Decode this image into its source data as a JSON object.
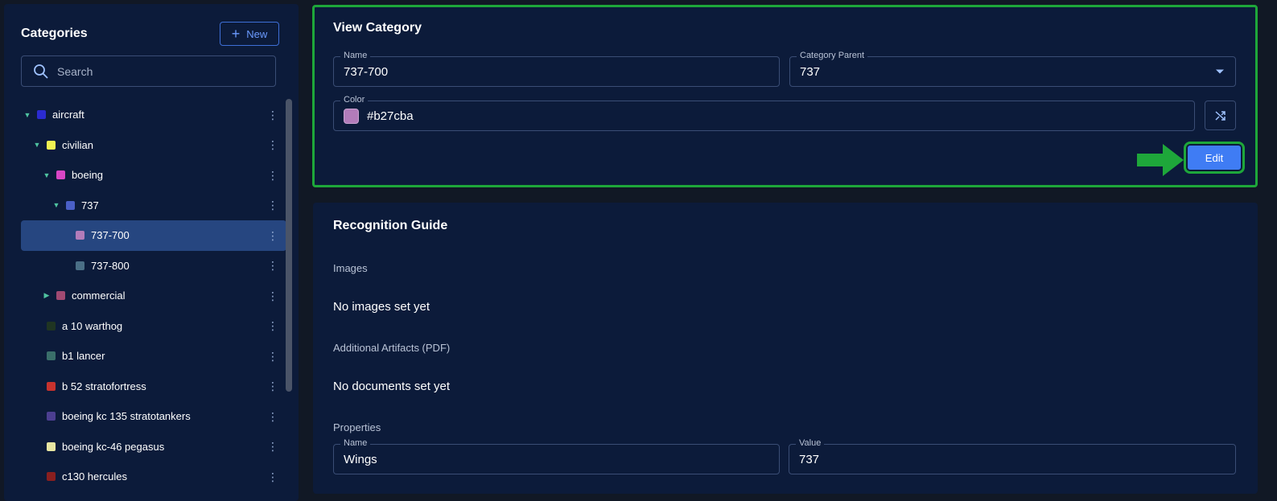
{
  "sidebar": {
    "title": "Categories",
    "new_label": "New",
    "search_placeholder": "Search",
    "items": [
      {
        "label": "aircraft",
        "level": 0,
        "caret": "down",
        "color": "#2b2bd0"
      },
      {
        "label": "civilian",
        "level": 1,
        "caret": "down",
        "color": "#f2f252"
      },
      {
        "label": "boeing",
        "level": 2,
        "caret": "down",
        "color": "#d946c6"
      },
      {
        "label": "737",
        "level": 3,
        "caret": "down",
        "color": "#4a5fc6"
      },
      {
        "label": "737-700",
        "level": 4,
        "caret": "none",
        "color": "#b27cba",
        "selected": true
      },
      {
        "label": "737-800",
        "level": 4,
        "caret": "none",
        "color": "#4a6f86"
      },
      {
        "label": "commercial",
        "level": 2,
        "caret": "right",
        "color": "#a04a72"
      },
      {
        "label": "a 10 warthog",
        "level": 1,
        "caret": "none",
        "color": "#1f3522"
      },
      {
        "label": "b1 lancer",
        "level": 1,
        "caret": "none",
        "color": "#3a6f6a"
      },
      {
        "label": "b 52 stratofortress",
        "level": 1,
        "caret": "none",
        "color": "#c8332e"
      },
      {
        "label": "boeing kc 135 stratotankers",
        "level": 1,
        "caret": "none",
        "color": "#4c3f91"
      },
      {
        "label": "boeing kc-46 pegasus",
        "level": 1,
        "caret": "none",
        "color": "#e8e6a2"
      },
      {
        "label": "c130 hercules",
        "level": 1,
        "caret": "none",
        "color": "#8a1f1f"
      }
    ]
  },
  "view": {
    "title": "View Category",
    "name_legend": "Name",
    "name_value": "737-700",
    "parent_legend": "Category Parent",
    "parent_value": "737",
    "color_legend": "Color",
    "color_value": "#b27cba",
    "edit_label": "Edit"
  },
  "guide": {
    "title": "Recognition Guide",
    "images_label": "Images",
    "images_empty": "No images set yet",
    "artifacts_label": "Additional Artifacts (PDF)",
    "artifacts_empty": "No documents set yet",
    "properties_label": "Properties",
    "prop_name_legend": "Name",
    "prop_name_value": "Wings",
    "prop_value_legend": "Value",
    "prop_value_value": "737"
  },
  "colors": {
    "highlight": "#1ea73a",
    "accent": "#3f7cf4"
  },
  "icons": {
    "search": "search-icon",
    "plus": "plus-icon",
    "shuffle": "shuffle-icon",
    "kebab": "kebab-menu-icon",
    "arrow": "arrow-right-icon"
  }
}
